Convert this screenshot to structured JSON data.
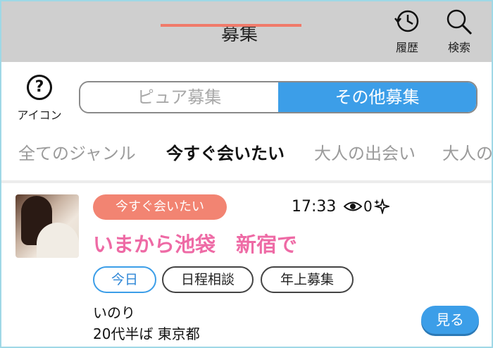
{
  "header": {
    "title": "募集",
    "history_label": "履歴",
    "search_label": "検索"
  },
  "help": {
    "label": "アイコン",
    "symbol": "?"
  },
  "segment": {
    "items": [
      {
        "label": "ピュア募集",
        "active": false
      },
      {
        "label": "その他募集",
        "active": true
      }
    ]
  },
  "genres": [
    {
      "label": "全てのジャンル",
      "active": false
    },
    {
      "label": "今すぐ会いたい",
      "active": true
    },
    {
      "label": "大人の出会い",
      "active": false
    },
    {
      "label": "大人の",
      "active": false
    }
  ],
  "post": {
    "genre_badge": "今すぐ会いたい",
    "time": "17:33",
    "views": "0",
    "title": "いまから池袋　新宿で",
    "tags": [
      "今日",
      "日程相談",
      "年上募集"
    ],
    "poster_name": "いのり",
    "poster_info": "20代半ば 東京都",
    "view_button": "見る"
  },
  "colors": {
    "header_bg": "#cfcfcf",
    "accent_blue": "#3c9ee8",
    "badge_salmon": "#f28472",
    "title_pink": "#ee6aa5",
    "underline": "#f07a6a"
  },
  "icons": [
    "history-icon",
    "search-icon",
    "help-icon",
    "eye-icon",
    "sparkle-icon"
  ]
}
